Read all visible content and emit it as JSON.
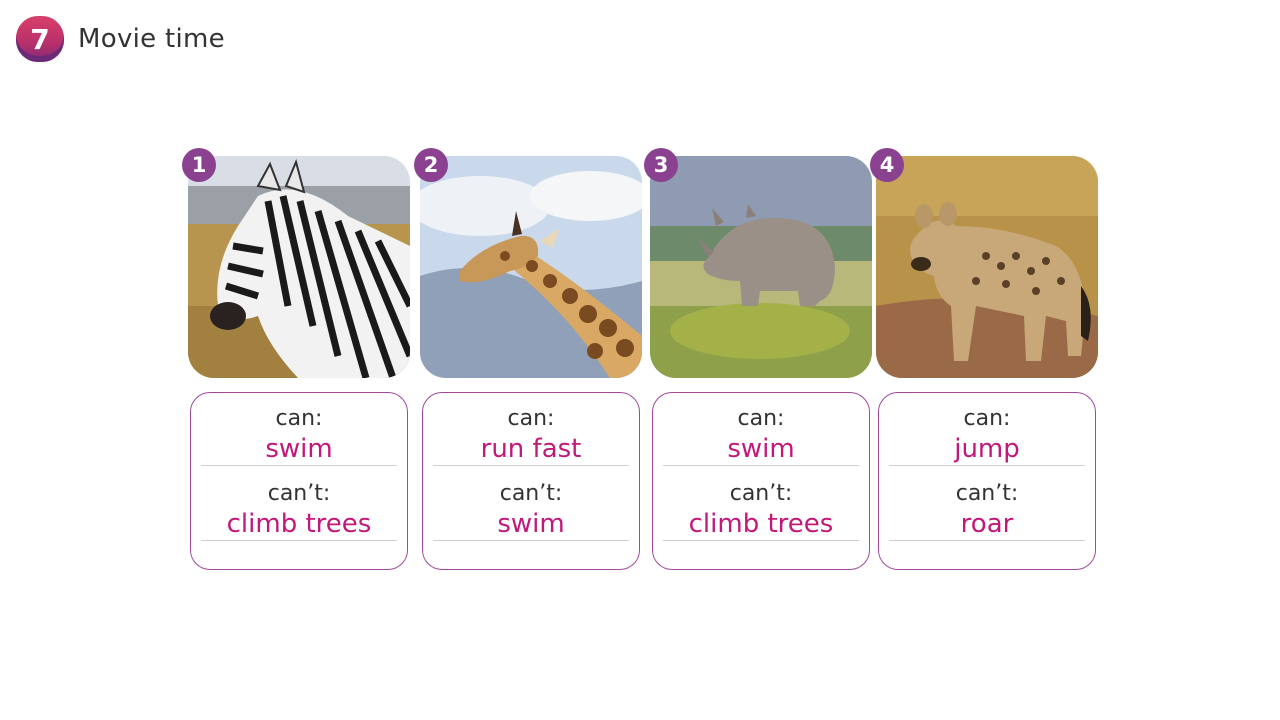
{
  "header": {
    "lesson_number": "7",
    "title": "Movie time"
  },
  "colors": {
    "accent": "#8a4290",
    "answer_text": "#c2187a",
    "box_border": "#a04a9c"
  },
  "cards": [
    {
      "number": "1",
      "animal_icon": "zebra-photo",
      "can_label": "can:",
      "can_value": "swim",
      "cant_label": "can’t:",
      "cant_value": "climb trees"
    },
    {
      "number": "2",
      "animal_icon": "giraffe-photo",
      "can_label": "can:",
      "can_value": "run fast",
      "cant_label": "can’t:",
      "cant_value": "swim"
    },
    {
      "number": "3",
      "animal_icon": "rhino-photo",
      "can_label": "can:",
      "can_value": "swim",
      "cant_label": "can’t:",
      "cant_value": "climb trees"
    },
    {
      "number": "4",
      "animal_icon": "hyena-photo",
      "can_label": "can:",
      "can_value": "jump",
      "cant_label": "can’t:",
      "cant_value": "roar"
    }
  ]
}
